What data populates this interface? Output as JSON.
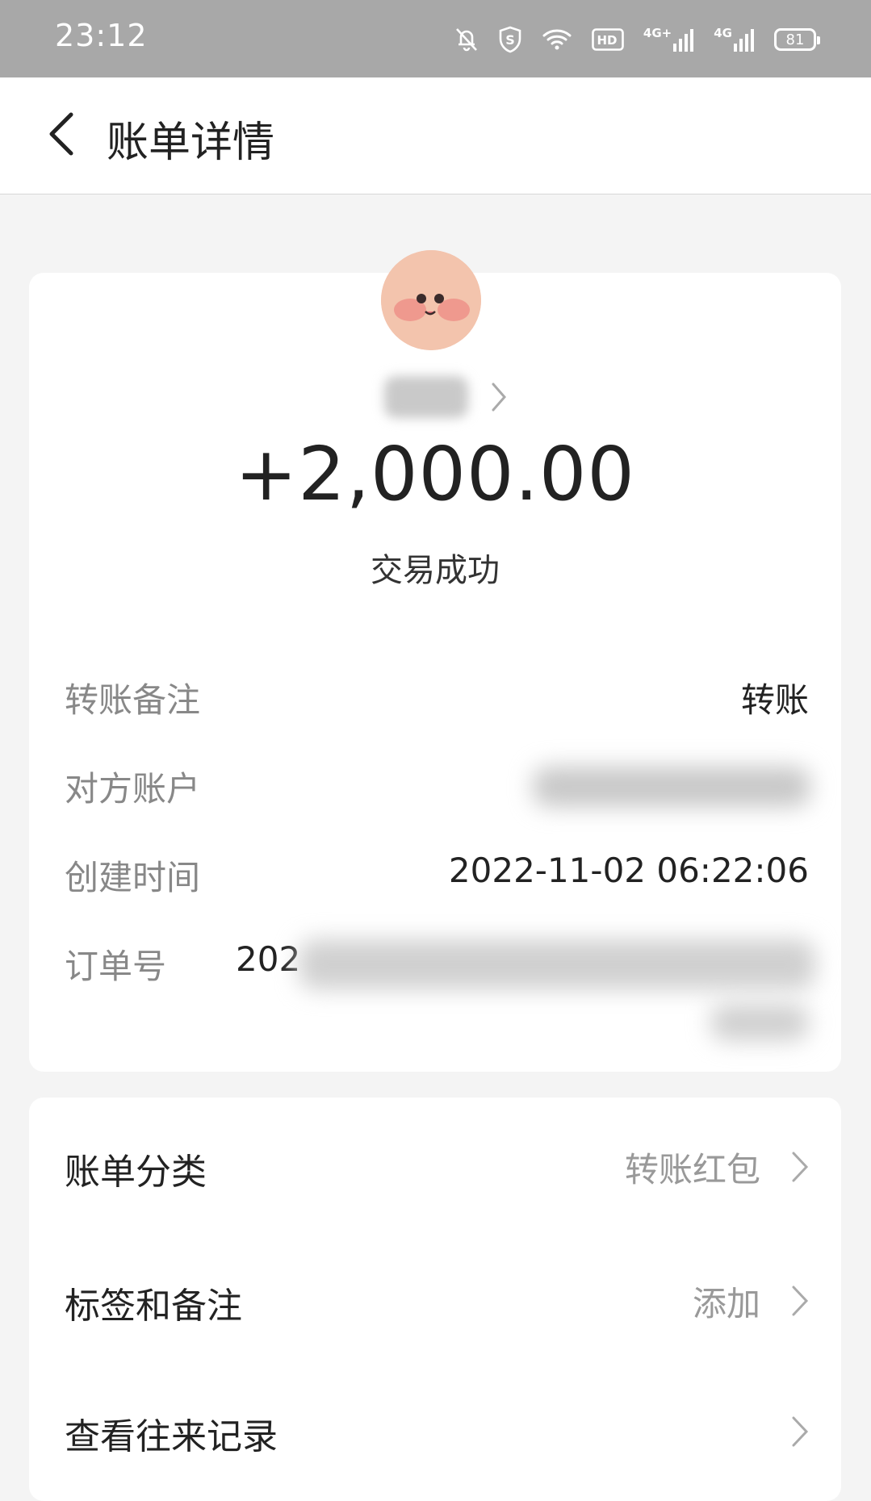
{
  "status_bar": {
    "time": "23:12",
    "icons": [
      "bell-off-icon",
      "shield-s-icon",
      "wifi-icon",
      "hd-icon",
      "signal-4g-icon",
      "signal-4g-icon",
      "battery-icon"
    ],
    "hd_label": "HD",
    "net1_label": "4G+",
    "net2_label": "4G",
    "battery_level": "81"
  },
  "header": {
    "back_icon": "chevron-left-icon",
    "title": "账单详情"
  },
  "transaction": {
    "amount": "+2,000.00",
    "status": "交易成功"
  },
  "details": [
    {
      "label": "转账备注",
      "value": "转账"
    },
    {
      "label": "对方账户",
      "value": ""
    },
    {
      "label": "创建时间",
      "value": "2022-11-02 06:22:06"
    },
    {
      "label": "订单号",
      "value": "202"
    }
  ],
  "menu": [
    {
      "label": "账单分类",
      "value": "转账红包"
    },
    {
      "label": "标签和备注",
      "value": "添加"
    },
    {
      "label": "查看往来记录",
      "value": ""
    }
  ]
}
